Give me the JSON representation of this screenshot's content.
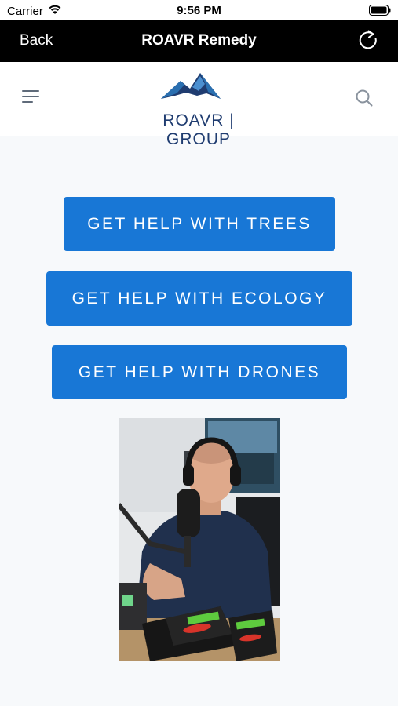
{
  "status_bar": {
    "carrier": "Carrier",
    "time": "9:56 PM"
  },
  "nav": {
    "back_label": "Back",
    "title": "ROAVR Remedy"
  },
  "header": {
    "logo_text": "ROAVR | GROUP"
  },
  "buttons": {
    "trees": "GET HELP WITH TREES",
    "ecology": "GET HELP WITH ECOLOGY",
    "drones": "GET HELP WITH DRONES"
  },
  "colors": {
    "button": "#1877d6",
    "nav_bar": "#000000",
    "logo": "#1f3c70"
  },
  "icons": [
    "wifi-icon",
    "battery-icon",
    "refresh-icon",
    "menu-icon",
    "search-icon",
    "mountain-logo-icon"
  ]
}
